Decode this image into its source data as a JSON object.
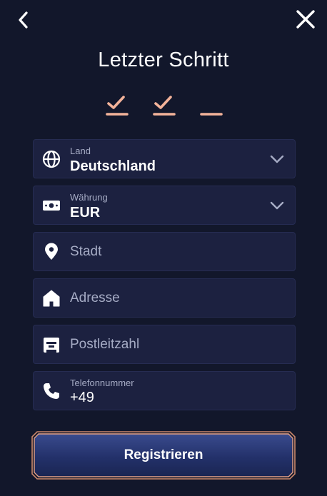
{
  "header": {
    "back_icon": "chevron-left-icon",
    "close_icon": "close-icon",
    "title": "Letzter Schritt"
  },
  "steps": [
    {
      "state": "done",
      "icon": "check-icon"
    },
    {
      "state": "done",
      "icon": "check-icon"
    },
    {
      "state": "current",
      "icon": "dash-icon"
    }
  ],
  "form": {
    "country": {
      "label": "Land",
      "value": "Deutschland",
      "icon": "globe-icon"
    },
    "currency": {
      "label": "Währung",
      "value": "EUR",
      "icon": "banknote-icon"
    },
    "city": {
      "placeholder": "Stadt",
      "icon": "map-pin-icon"
    },
    "address": {
      "placeholder": "Adresse",
      "icon": "home-icon"
    },
    "postal_code": {
      "placeholder": "Postleitzahl",
      "icon": "mailbox-icon"
    },
    "phone": {
      "label": "Telefonnummer",
      "value": "+49",
      "icon": "phone-icon"
    }
  },
  "submit": {
    "label": "Registrieren"
  },
  "colors": {
    "background": "#12172b",
    "field_bg": "#1c2140",
    "accent_peach": "#f3b39a",
    "button_blue": "#23316a",
    "button_border": "#c9866b"
  }
}
